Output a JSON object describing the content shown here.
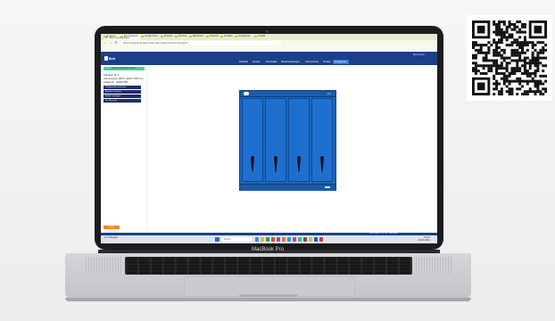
{
  "browser": {
    "tab_title": "Bott Configurator",
    "address": "https://www.bott.de/configurator/rack-cabinet?config=lz",
    "bookmarks": [
      "Lieferant",
      "Bott Startseite",
      "Google Drive",
      "Projekte",
      "Rechner",
      "Mitarbeiter",
      "Kalender",
      "Kontakte",
      "Konfigurator",
      "ToolDB"
    ]
  },
  "site": {
    "logo_text": "Bott",
    "user_link": "Mein Konto",
    "menu": [
      {
        "label": "Produkte",
        "active": false
      },
      {
        "label": "Service",
        "active": false
      },
      {
        "label": "Downloads",
        "active": false
      },
      {
        "label": "Branchenlösungen",
        "active": false
      },
      {
        "label": "Unternehmen",
        "active": false
      },
      {
        "label": "Kontakt",
        "active": false
      },
      {
        "label": "Konfigurator",
        "active": true
      }
    ]
  },
  "sidebar": {
    "top_button": "Neue Konfiguration starten",
    "lines": [
      "Schrank: Nr. 1",
      "Abmessung: 1000 x 1100 x 650 mm",
      "Artikel-Nr.: 40022-050"
    ],
    "buttons": [
      "Konfiguration speichern",
      "Angebot anfordern",
      "Artikel hinzufügen",
      "Zur Übersicht"
    ],
    "bottom_button": "Zurück"
  },
  "cabinet": {
    "number": "1/1",
    "doors": 4,
    "body_color": "#1d66be"
  },
  "footer": {
    "text": "© Bott GmbH & Co. KG · Impressum"
  },
  "taskbar": {
    "weather": "12°C Bewölkt",
    "search": "Suche",
    "time": "10:24",
    "date": "18.04.2024",
    "icon_colors": [
      "#3a86e8",
      "#f0b030",
      "#2aa04a",
      "#e04a3a",
      "#7b4fd0",
      "#e07a2a",
      "#1a9fd0",
      "#d03a7a",
      "#3ab0a0",
      "#5a5a5a",
      "#e0c030",
      "#1a5cae",
      "#c04040"
    ]
  },
  "laptop": {
    "model": "MacBook Pro"
  }
}
